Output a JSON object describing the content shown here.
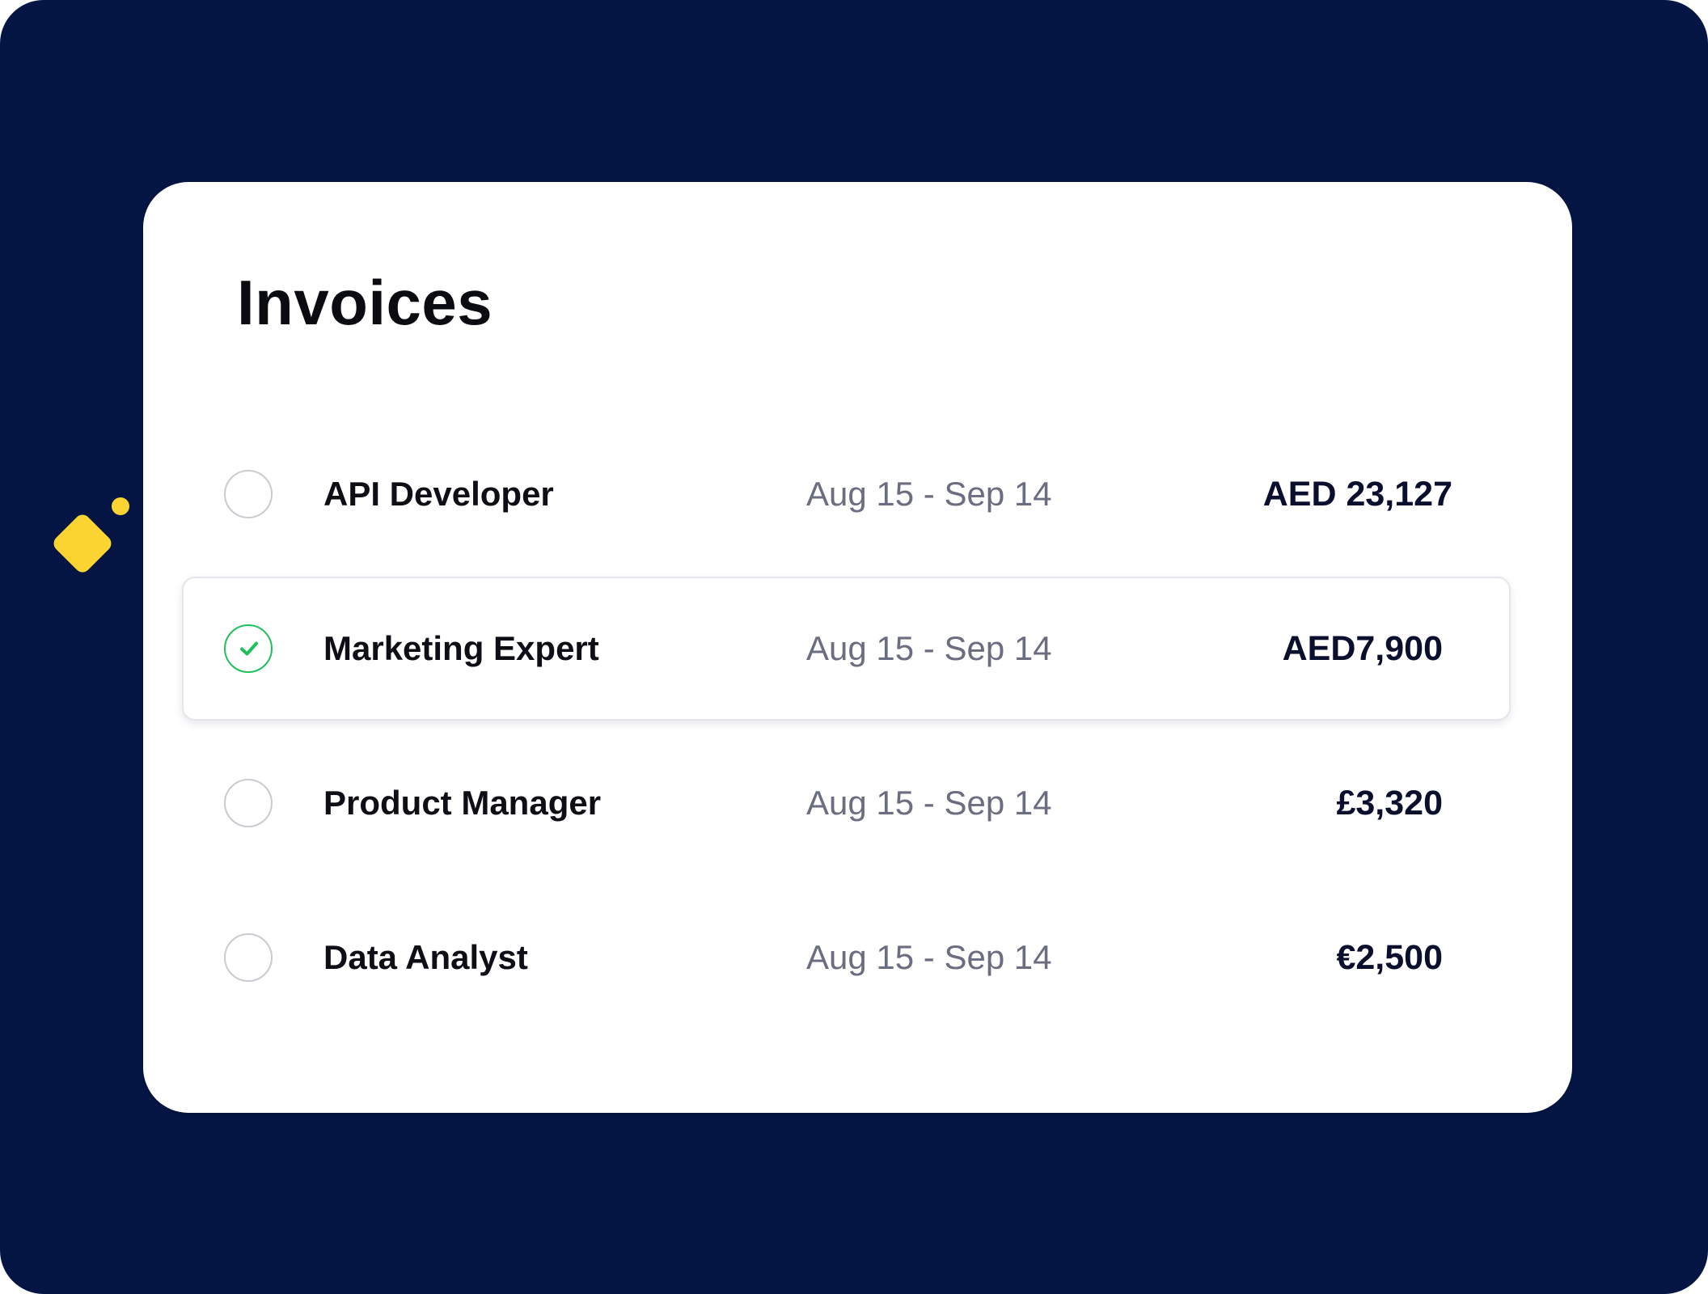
{
  "invoices": {
    "title": "Invoices",
    "rows": [
      {
        "role": "API Developer",
        "period": "Aug 15 - Sep 14",
        "amount": "AED 23,127",
        "selected": false
      },
      {
        "role": "Marketing Expert",
        "period": "Aug 15 - Sep 14",
        "amount": "AED7,900",
        "selected": true
      },
      {
        "role": "Product Manager",
        "period": "Aug 15 - Sep 14",
        "amount": "£3,320",
        "selected": false
      },
      {
        "role": "Data Analyst",
        "period": "Aug 15 - Sep 14",
        "amount": "€2,500",
        "selected": false
      }
    ]
  },
  "colors": {
    "background": "#041544",
    "accent_yellow": "#FCD432",
    "check_green": "#1FBF5B",
    "card": "#FFFFFF"
  },
  "icons": {
    "selected_indicator": "checkmark-icon",
    "decoration": "diamond-shape"
  }
}
